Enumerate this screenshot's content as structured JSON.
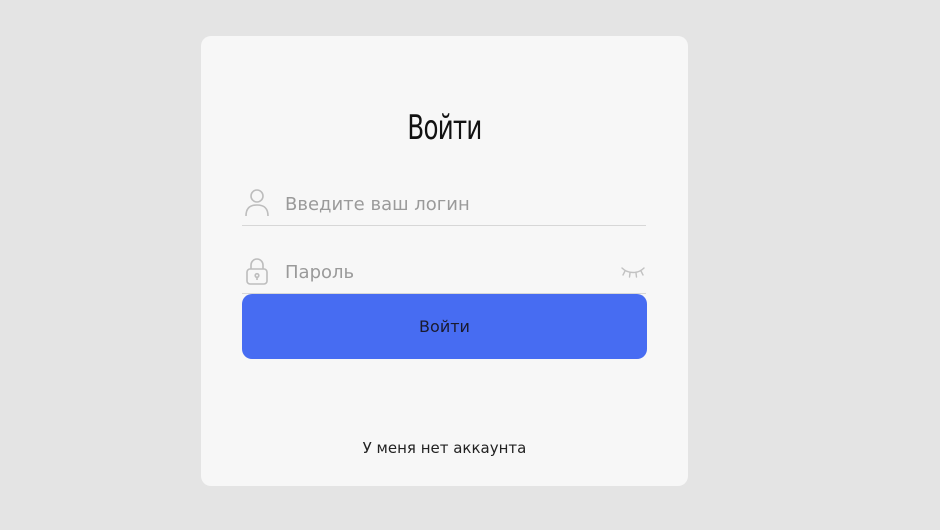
{
  "login_form": {
    "title": "Войти",
    "login_field": {
      "placeholder": "Введите ваш логин",
      "value": "",
      "icon": "user-icon"
    },
    "password_field": {
      "placeholder": "Пароль",
      "value": "",
      "icon": "lock-icon",
      "toggle_icon": "eye-closed-icon"
    },
    "submit_label": "Войти",
    "no_account_link": "У меня нет аккаунта"
  },
  "colors": {
    "page_background": "#e4e4e4",
    "card_background": "#f7f7f7",
    "accent": "#476cf2",
    "icon_stroke": "#bdbdbd",
    "divider": "#d7d7d7"
  }
}
